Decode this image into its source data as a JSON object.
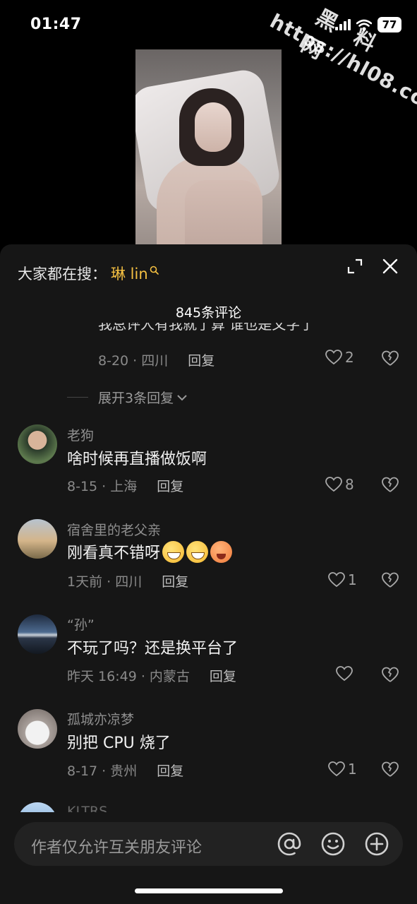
{
  "status_bar": {
    "time": "01:47",
    "battery": "77"
  },
  "watermark": {
    "name": "黑 料 网",
    "url": "https://hl08.co"
  },
  "comments_panel": {
    "search_hint_label": "大家都在搜：",
    "search_term": "琳 lin",
    "comment_count": "845条评论",
    "partial_comment": {
      "text": "我总评人有我就了算 谁也是文字了",
      "date_location": "8-20 · 四川",
      "reply_label": "回复",
      "likes": "2"
    },
    "expand_replies": "展开3条回复",
    "comments": [
      {
        "username": "老狗",
        "text": "啥时候再直播做饭啊",
        "date_location": "8-15 · 上海",
        "reply_label": "回复",
        "likes": "8"
      },
      {
        "username": "宿舍里的老父亲",
        "text": "刚看真不错呀",
        "emojis": [
          "grin-emoji",
          "grin-emoji",
          "heart-eyes-emoji"
        ],
        "date_location": "1天前 · 四川",
        "reply_label": "回复",
        "likes": "1"
      },
      {
        "username": "“孙”",
        "text": "不玩了吗？还是换平台了",
        "date_location": "昨天 16:49 · 内蒙古",
        "reply_label": "回复",
        "likes": ""
      },
      {
        "username": "孤城亦凉梦",
        "text": "别把 CPU 烧了",
        "date_location": "8-17 · 贵州",
        "reply_label": "回复",
        "likes": "1"
      }
    ],
    "peek_username": "KLTRS"
  },
  "input_bar": {
    "placeholder": "作者仅允许互关朋友评论"
  },
  "colors": {
    "accent": "#f4c042",
    "panel_bg": "#161616",
    "input_bg": "#222222"
  }
}
